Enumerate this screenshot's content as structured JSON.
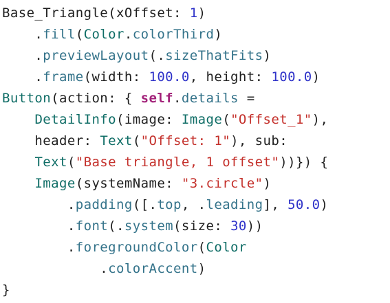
{
  "editor": {
    "lines": [
      [
        {
          "t": "Base_Triangle(xOffset: ",
          "k": "plain"
        },
        {
          "t": "1",
          "k": "number"
        },
        {
          "t": ")",
          "k": "plain"
        }
      ],
      [
        {
          "t": "    .",
          "k": "plain"
        },
        {
          "t": "fill",
          "k": "member"
        },
        {
          "t": "(",
          "k": "plain"
        },
        {
          "t": "Color",
          "k": "type"
        },
        {
          "t": ".",
          "k": "plain"
        },
        {
          "t": "colorThird",
          "k": "member"
        },
        {
          "t": ")",
          "k": "plain"
        }
      ],
      [
        {
          "t": "    .",
          "k": "plain"
        },
        {
          "t": "previewLayout",
          "k": "member"
        },
        {
          "t": "(.",
          "k": "plain"
        },
        {
          "t": "sizeThatFits",
          "k": "member"
        },
        {
          "t": ")",
          "k": "plain"
        }
      ],
      [
        {
          "t": "    .",
          "k": "plain"
        },
        {
          "t": "frame",
          "k": "member"
        },
        {
          "t": "(width: ",
          "k": "plain"
        },
        {
          "t": "100.0",
          "k": "number"
        },
        {
          "t": ", height: ",
          "k": "plain"
        },
        {
          "t": "100.0",
          "k": "number"
        },
        {
          "t": ")",
          "k": "plain"
        }
      ],
      [
        {
          "t": "Button",
          "k": "type"
        },
        {
          "t": "(action: { ",
          "k": "plain"
        },
        {
          "t": "self",
          "k": "keyword"
        },
        {
          "t": ".",
          "k": "plain"
        },
        {
          "t": "details",
          "k": "member"
        },
        {
          "t": " =",
          "k": "plain"
        }
      ],
      [
        {
          "t": "    ",
          "k": "plain"
        },
        {
          "t": "DetailInfo",
          "k": "type"
        },
        {
          "t": "(image: ",
          "k": "plain"
        },
        {
          "t": "Image",
          "k": "type"
        },
        {
          "t": "(",
          "k": "plain"
        },
        {
          "t": "\"Offset_1\"",
          "k": "string"
        },
        {
          "t": "),",
          "k": "plain"
        }
      ],
      [
        {
          "t": "    header: ",
          "k": "plain"
        },
        {
          "t": "Text",
          "k": "type"
        },
        {
          "t": "(",
          "k": "plain"
        },
        {
          "t": "\"Offset: 1\"",
          "k": "string"
        },
        {
          "t": "), sub:",
          "k": "plain"
        }
      ],
      [
        {
          "t": "    ",
          "k": "plain"
        },
        {
          "t": "Text",
          "k": "type"
        },
        {
          "t": "(",
          "k": "plain"
        },
        {
          "t": "\"Base triangle, 1 offset\"",
          "k": "string"
        },
        {
          "t": "))}) {",
          "k": "plain"
        }
      ],
      [
        {
          "t": "    ",
          "k": "plain"
        },
        {
          "t": "Image",
          "k": "type"
        },
        {
          "t": "(systemName: ",
          "k": "plain"
        },
        {
          "t": "\"3.circle\"",
          "k": "string"
        },
        {
          "t": ")",
          "k": "plain"
        }
      ],
      [
        {
          "t": "        .",
          "k": "plain"
        },
        {
          "t": "padding",
          "k": "member"
        },
        {
          "t": "([.",
          "k": "plain"
        },
        {
          "t": "top",
          "k": "member"
        },
        {
          "t": ", .",
          "k": "plain"
        },
        {
          "t": "leading",
          "k": "member"
        },
        {
          "t": "], ",
          "k": "plain"
        },
        {
          "t": "50.0",
          "k": "number"
        },
        {
          "t": ")",
          "k": "plain"
        }
      ],
      [
        {
          "t": "        .",
          "k": "plain"
        },
        {
          "t": "font",
          "k": "member"
        },
        {
          "t": "(.",
          "k": "plain"
        },
        {
          "t": "system",
          "k": "member"
        },
        {
          "t": "(size: ",
          "k": "plain"
        },
        {
          "t": "30",
          "k": "number"
        },
        {
          "t": "))",
          "k": "plain"
        }
      ],
      [
        {
          "t": "        .",
          "k": "plain"
        },
        {
          "t": "foregroundColor",
          "k": "member"
        },
        {
          "t": "(",
          "k": "plain"
        },
        {
          "t": "Color",
          "k": "type"
        }
      ],
      [
        {
          "t": "            .",
          "k": "plain"
        },
        {
          "t": "colorAccent",
          "k": "member"
        },
        {
          "t": ")",
          "k": "plain"
        }
      ],
      [
        {
          "t": "}",
          "k": "plain"
        }
      ]
    ]
  },
  "colors": {
    "background": "#ffffff",
    "plain": "#1f1f1f",
    "member": "#34738a",
    "type": "#0f6d66",
    "string": "#c4302b",
    "number": "#2f33c9",
    "keyword": "#a3227a"
  }
}
